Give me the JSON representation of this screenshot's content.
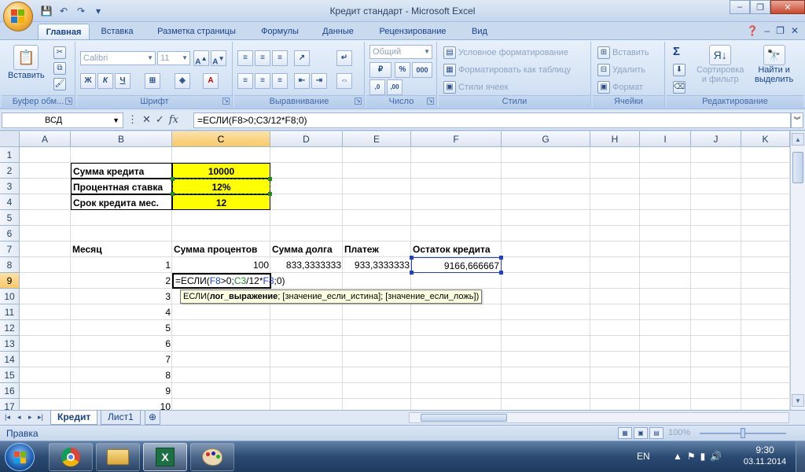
{
  "window": {
    "title": "Кредит стандарт - Microsoft Excel",
    "buttons": {
      "minimize": "–",
      "restore": "❐",
      "close": "✕"
    }
  },
  "qat": {
    "save_icon": "💾",
    "undo_icon": "↶",
    "redo_icon": "↷",
    "customize_icon": "▾"
  },
  "ribbon": {
    "tabs": [
      "Главная",
      "Вставка",
      "Разметка страницы",
      "Формулы",
      "Данные",
      "Рецензирование",
      "Вид"
    ],
    "active_tab": "Главная",
    "groups": {
      "clipboard": {
        "label": "Буфер обм...",
        "paste": "Вставить"
      },
      "font": {
        "label": "Шрифт",
        "font_name": "Calibri",
        "font_size": "11",
        "bold": "Ж",
        "italic": "К",
        "underline": "Ч"
      },
      "alignment": {
        "label": "Выравнивание"
      },
      "number": {
        "label": "Число",
        "format": "Общий",
        "percent": "%",
        "thousands": "000"
      },
      "styles": {
        "label": "Стили",
        "conditional": "Условное форматирование",
        "as_table": "Форматировать как таблицу",
        "cell_styles": "Стили ячеек"
      },
      "cells": {
        "label": "Ячейки",
        "insert": "Вставить",
        "delete": "Удалить",
        "format": "Формат"
      },
      "editing": {
        "label": "Редактирование",
        "sum_icon": "Σ",
        "sort": "Сортировка",
        "sort2": "и фильтр",
        "find": "Найти и",
        "find2": "выделить"
      }
    }
  },
  "formula_bar": {
    "name_box": "ВСД",
    "fx_label": "fx",
    "cancel": "✕",
    "enter": "✓",
    "formula": "=ЕСЛИ(F8>0;C3/12*F8;0)",
    "expand_icon": "︾"
  },
  "grid": {
    "columns": [
      "A",
      "B",
      "C",
      "D",
      "E",
      "F",
      "G",
      "H",
      "I",
      "J",
      "K"
    ],
    "rows": [
      "1",
      "2",
      "3",
      "4",
      "5",
      "6",
      "7",
      "8",
      "9",
      "10",
      "11",
      "12",
      "13",
      "14",
      "15",
      "16",
      "17"
    ],
    "selected_column": "C",
    "selected_row": "9",
    "cells": {
      "B2": "Сумма кредита",
      "C2": "10000",
      "B3": "Процентная ставка",
      "C3": "12%",
      "B4": "Срок кредита мес.",
      "C4": "12",
      "B7": "Месяц",
      "C7": "Сумма процентов",
      "D7": "Сумма долга",
      "E7": "Платеж",
      "F7": "Остаток кредита",
      "B8": "1",
      "C8": "100",
      "D8": "833,3333333",
      "E8": "933,3333333",
      "F8": "9166,666667",
      "B9": "2",
      "B10": "3",
      "B11": "4",
      "B12": "5",
      "B13": "6",
      "B14": "7",
      "B15": "8",
      "B16": "9",
      "B17": "10"
    },
    "editing": {
      "cell": "C9",
      "parts": [
        {
          "text": "=ЕСЛИ(",
          "color": "#000000"
        },
        {
          "text": "F8",
          "color": "#1f3fcf"
        },
        {
          "text": ">0;",
          "color": "#000000"
        },
        {
          "text": "C3",
          "color": "#1e8c1e"
        },
        {
          "text": "/12*",
          "color": "#000000"
        },
        {
          "text": "F8",
          "color": "#1f3fcf"
        },
        {
          "text": ";0)",
          "color": "#000000"
        }
      ]
    },
    "tooltip": {
      "func": "ЕСЛИ(",
      "arg1": "лог_выражение",
      "rest": "; [значение_если_истина]; [значение_если_ложь])"
    }
  },
  "sheets": {
    "tabs": [
      "Кредит",
      "Лист1"
    ],
    "active": "Кредит",
    "nav": [
      "|◂",
      "◂",
      "▸",
      "▸|"
    ]
  },
  "status": {
    "mode": "Правка",
    "zoom": "100%"
  },
  "taskbar": {
    "lang": "EN",
    "time": "9:30",
    "date": "03.11.2014",
    "apps": [
      "chrome-icon",
      "explorer-icon",
      "excel-icon",
      "paint-icon"
    ]
  },
  "colors": {
    "yellow": "#ffff00",
    "ref_blue": "#1f3fcf",
    "ref_green": "#1e8c1e"
  }
}
